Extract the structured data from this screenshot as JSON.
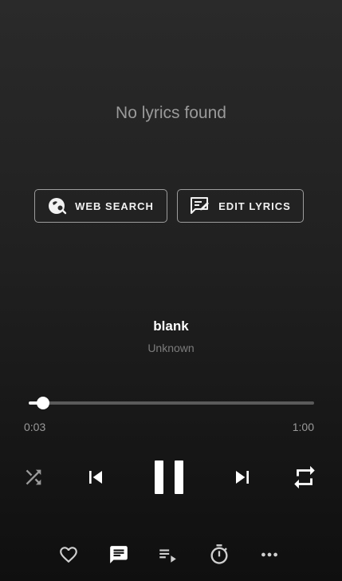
{
  "lyrics": {
    "empty_message": "No lyrics found",
    "web_search_label": "WEB SEARCH",
    "edit_lyrics_label": "EDIT LYRICS"
  },
  "track": {
    "title": "blank",
    "artist": "Unknown"
  },
  "progress": {
    "elapsed": "0:03",
    "total": "1:00",
    "fraction": 0.05
  },
  "controls": {
    "shuffle_icon": "shuffle-icon",
    "previous_icon": "skip-previous-icon",
    "play_state_icon": "pause-icon",
    "next_icon": "skip-next-icon",
    "repeat_icon": "repeat-icon"
  },
  "bottom_bar": [
    "heart-icon",
    "lyrics-icon",
    "queue-icon",
    "timer-icon",
    "more-icon"
  ],
  "colors": {
    "background_top": "#2a2a2a",
    "background_bottom": "#0f0f0f",
    "muted_text": "#9a9a9a",
    "accent": "#ffffff"
  }
}
